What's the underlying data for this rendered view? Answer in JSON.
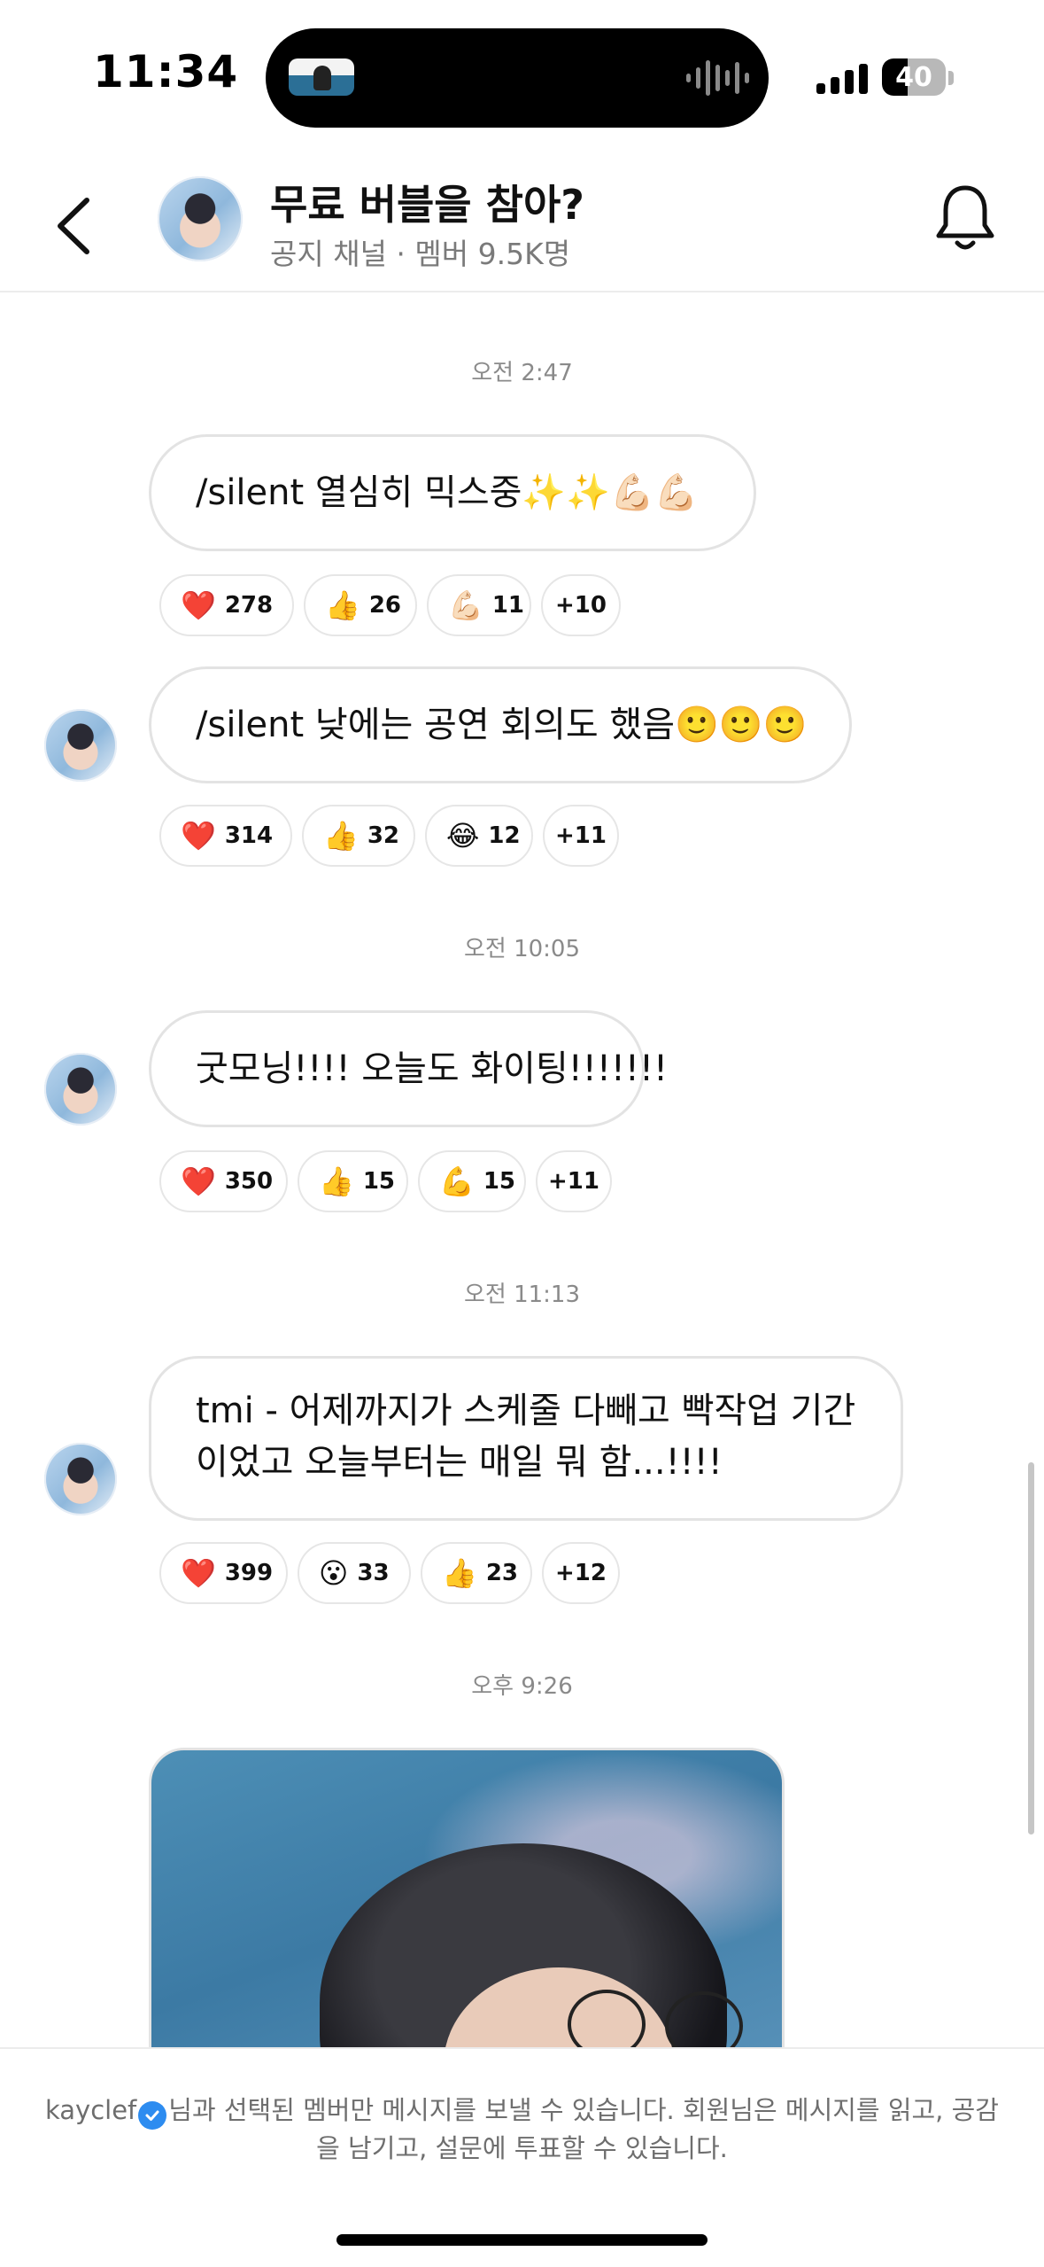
{
  "status_bar": {
    "time": "11:34",
    "battery": "40",
    "battery_fraction": 0.4
  },
  "header": {
    "title": "무료 버블을 참아?",
    "subtitle": "공지 채널 · 멤버 9.5K명"
  },
  "colors": {
    "heart": "#e0242b",
    "verified": "#2d8cf0",
    "border": "#e3e3e3",
    "timestamp": "#8a8a8a"
  },
  "messages": [
    {
      "time": "오전 2:47",
      "text": "/silent 열심히 믹스중✨✨💪🏻💪🏻",
      "reactions": [
        {
          "emoji": "❤️",
          "icon": "heart-icon",
          "count": "278"
        },
        {
          "emoji": "👍",
          "icon": "thumbs-up-icon",
          "count": "26"
        },
        {
          "emoji": "💪🏻",
          "icon": "flexed-biceps-icon",
          "count": "11"
        }
      ],
      "more": "+10"
    },
    {
      "text": "/silent 낮에는 공연 회의도 했음🙂🙂🙂",
      "reactions": [
        {
          "emoji": "❤️",
          "icon": "heart-icon",
          "count": "314"
        },
        {
          "emoji": "👍",
          "icon": "thumbs-up-icon",
          "count": "32"
        },
        {
          "emoji": "😂",
          "icon": "laughing-icon",
          "count": "12"
        }
      ],
      "more": "+11"
    },
    {
      "time": "오전 10:05",
      "text": "굿모닝!!!! 오늘도 화이팅!!!!!!!",
      "reactions": [
        {
          "emoji": "❤️",
          "icon": "heart-icon",
          "count": "350"
        },
        {
          "emoji": "👍",
          "icon": "thumbs-up-icon",
          "count": "15"
        },
        {
          "emoji": "💪",
          "icon": "flexed-biceps-icon",
          "count": "15"
        }
      ],
      "more": "+11"
    },
    {
      "time": "오전 11:13",
      "text": "tmi - 어제까지가 스케줄 다빼고 빡작업 기간이었고 오늘부터는 매일 뭐 함...!!!!",
      "reactions": [
        {
          "emoji": "❤️",
          "icon": "heart-icon",
          "count": "399"
        },
        {
          "emoji": "😮",
          "icon": "surprised-icon",
          "count": "33"
        },
        {
          "emoji": "👍",
          "icon": "thumbs-up-icon",
          "count": "23"
        }
      ],
      "more": "+12"
    },
    {
      "time": "오후 9:26"
    }
  ],
  "footer": {
    "username": "kayclef",
    "notice_rest": "님과 선택된 멤버만 메시지를 보낼 수 있습니다. 회원님은 메시지를 읽고, 공감을 남기고, 설문에 투표할 수 있습니다."
  }
}
